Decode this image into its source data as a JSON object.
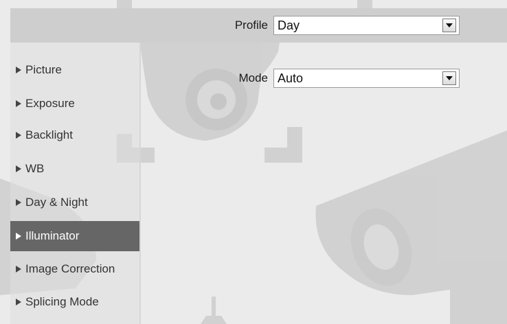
{
  "header": {
    "profile_label": "Profile",
    "profile_value": "Day"
  },
  "form": {
    "mode_label": "Mode",
    "mode_value": "Auto"
  },
  "sidebar": {
    "items": [
      {
        "label": "Picture",
        "active": false
      },
      {
        "label": "Exposure",
        "active": false
      },
      {
        "label": "Backlight",
        "active": false
      },
      {
        "label": "WB",
        "active": false
      },
      {
        "label": "Day & Night",
        "active": false
      },
      {
        "label": "Illuminator",
        "active": true
      },
      {
        "label": "Image Correction",
        "active": false
      },
      {
        "label": "Splicing Mode",
        "active": false
      }
    ]
  },
  "icons": {
    "nav_arrow": "caret-right-icon",
    "dropdown": "chevron-down-icon"
  },
  "colors": {
    "active_item_bg": "#666666",
    "active_item_text": "#ffffff",
    "header_bg": "#d3d3d3",
    "page_bg": "#ebebeb"
  }
}
